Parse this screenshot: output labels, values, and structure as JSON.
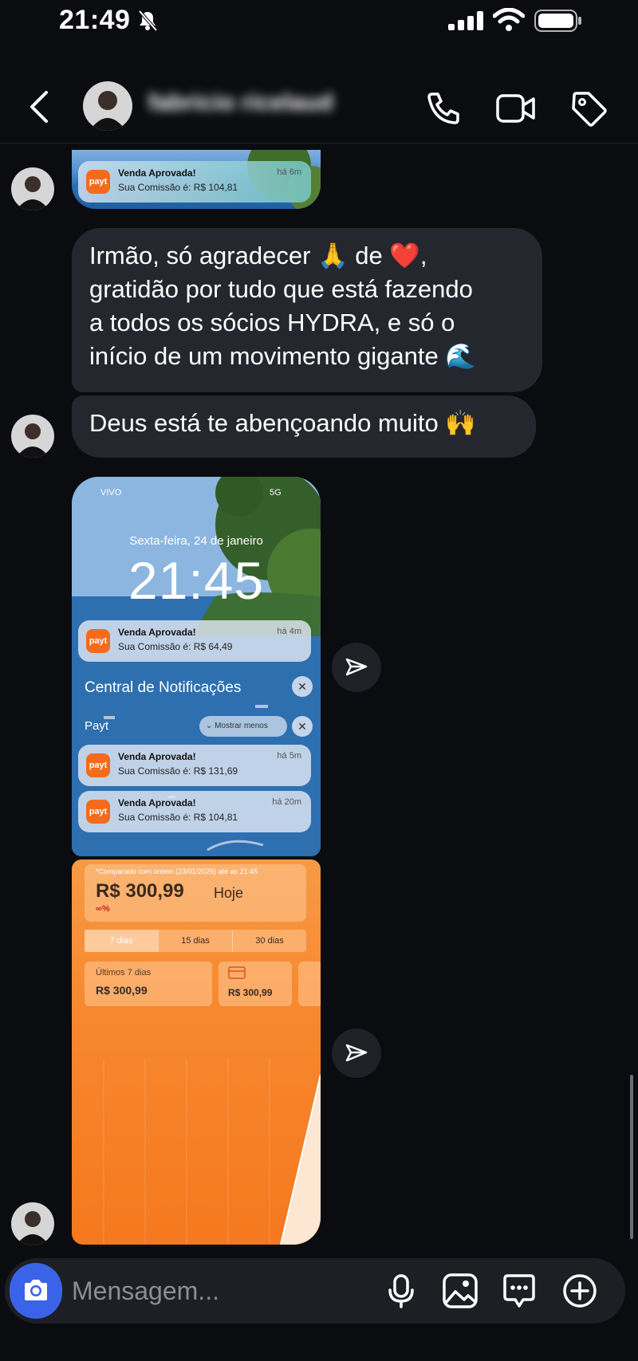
{
  "status_bar": {
    "time": "21:49",
    "icons": [
      "bell-slash-icon",
      "cellular-signal-icon",
      "wifi-icon",
      "battery-icon"
    ]
  },
  "header": {
    "contact_name": "fabricio ricelaud",
    "icons": [
      "chevron-left-icon",
      "phone-icon",
      "video-camera-icon",
      "tag-icon"
    ]
  },
  "messages": {
    "image_1": {
      "notification": {
        "app": "payt",
        "title": "Venda Aprovada!",
        "body": "Sua Comissão é: R$ 104,81",
        "time": "há 6m"
      }
    },
    "text_1": {
      "lines": [
        "Irmão, só agradecer 🙏 de ❤️,",
        "gratidão por tudo que está fazendo",
        "a todos os sócios HYDRA, e só o",
        "início de um movimento gigante 🌊"
      ]
    },
    "text_2": {
      "text": "Deus está te abençoando muito 🙌"
    },
    "image_2": {
      "carrier": "VIVO",
      "network": "5G",
      "date": "Sexta-feira, 24 de janeiro",
      "clock": "21:45",
      "top_notification": {
        "app": "payt",
        "title": "Venda Aprovada!",
        "body": "Sua Comissão é: R$ 64,49",
        "time": "há 4m"
      },
      "center_title": "Central de Notificações",
      "group_label": "Payt",
      "show_less": "Mostrar menos",
      "notifications": [
        {
          "app": "payt",
          "title": "Venda Aprovada!",
          "body": "Sua Comissão é: R$ 131,69",
          "time": "há 5m"
        },
        {
          "app": "payt",
          "title": "Venda Aprovada!",
          "body": "Sua Comissão é: R$ 104,81",
          "time": "há 20m"
        }
      ]
    },
    "image_3": {
      "compare_note": "*Comparado com ontem (23/01/2025) até as 21:45",
      "amount": "R$ 300,99",
      "amount_suffix": "Hoje",
      "change": "∞%",
      "tabs": [
        "7 dias",
        "15 dias",
        "30 dias"
      ],
      "active_tab": "7 dias",
      "card_1_label": "Últimos 7 dias",
      "card_1_value": "R$ 300,99",
      "card_2_value": "R$ 300,99"
    }
  },
  "composer": {
    "placeholder": "Mensagem...",
    "icons": [
      "camera-icon",
      "microphone-icon",
      "photo-icon",
      "chat-bubble-icon",
      "plus-circle-icon"
    ]
  },
  "colors": {
    "background": "#0b0c10",
    "bubble": "#25272e",
    "accent_blue": "#3a63e8",
    "payt_orange": "#f46b1b"
  }
}
